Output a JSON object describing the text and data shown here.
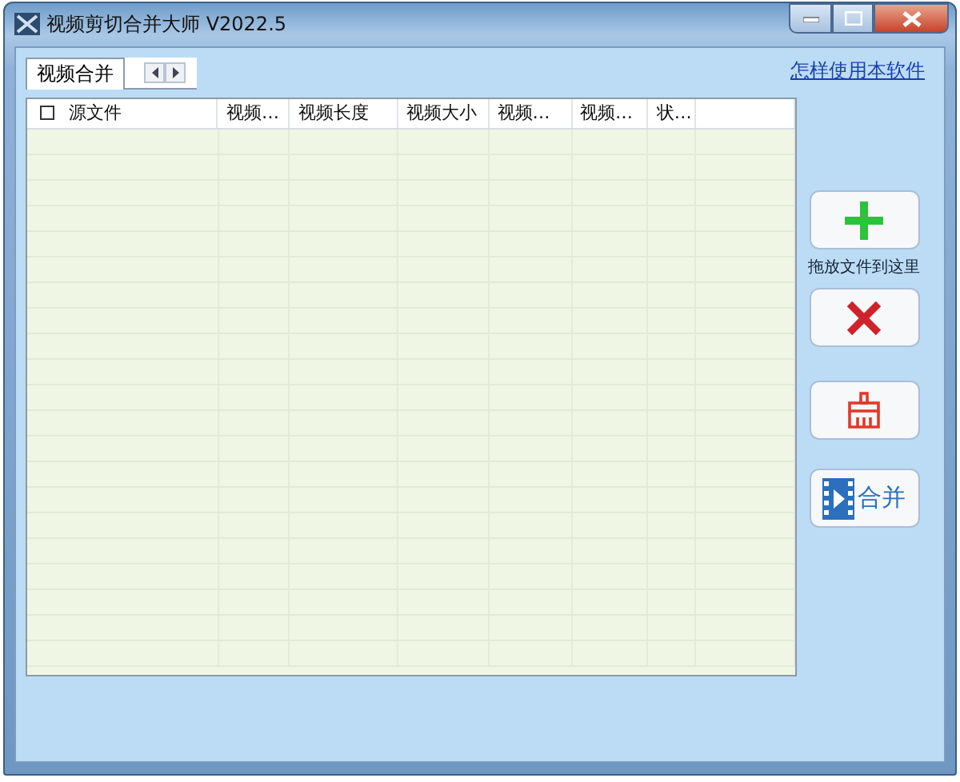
{
  "window": {
    "title": "视频剪切合并大师 V2022.5"
  },
  "tabs": [
    {
      "label": "视频合并",
      "selected": true
    }
  ],
  "help_link": "怎样使用本软件",
  "table": {
    "select_all_checked": false,
    "columns": [
      "源文件",
      "视频…",
      "视频长度",
      "视频大小",
      "视频…",
      "视频…",
      "状…"
    ]
  },
  "side_buttons": [
    {
      "kind": "add"
    },
    {
      "kind": "hint",
      "text": "拖放文件到这里"
    },
    {
      "kind": "delete"
    },
    {
      "kind": "clear"
    },
    {
      "kind": "merge",
      "label": "合并"
    }
  ]
}
